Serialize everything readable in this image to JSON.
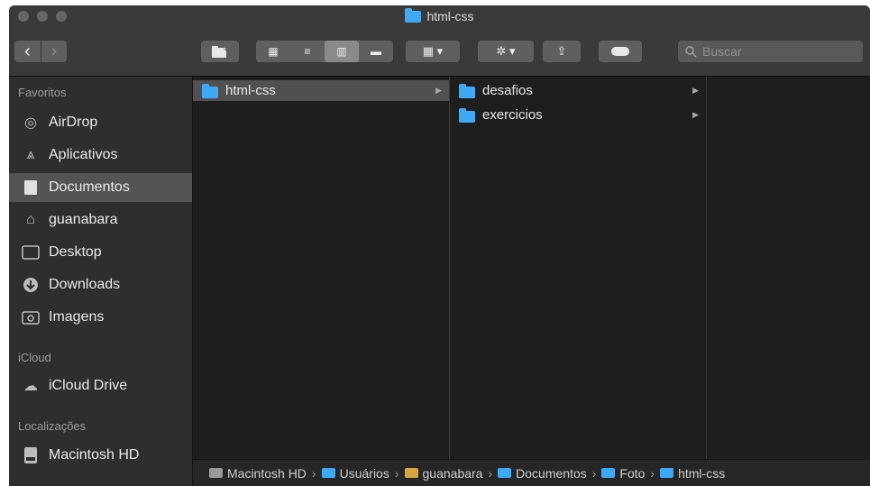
{
  "window": {
    "title": "html-css"
  },
  "toolbar": {
    "back_label": "‹",
    "forward_label": "›",
    "view_icons": [
      "▦",
      "≡",
      "▥",
      "▬"
    ],
    "group_label": "▦ ▾",
    "action_label": "✲ ▾",
    "share_label": "⇪",
    "tag_label": "●",
    "search_placeholder": "Buscar"
  },
  "sidebar": {
    "favorites_label": "Favoritos",
    "favorites": [
      {
        "label": "AirDrop",
        "icon": "airdrop-icon"
      },
      {
        "label": "Aplicativos",
        "icon": "applications-icon"
      },
      {
        "label": "Documentos",
        "icon": "documents-icon",
        "selected": true
      },
      {
        "label": "guanabara",
        "icon": "home-icon"
      },
      {
        "label": "Desktop",
        "icon": "desktop-icon"
      },
      {
        "label": "Downloads",
        "icon": "downloads-icon"
      },
      {
        "label": "Imagens",
        "icon": "pictures-icon"
      }
    ],
    "icloud_label": "iCloud",
    "icloud": [
      {
        "label": "iCloud Drive",
        "icon": "cloud-icon"
      }
    ],
    "locations_label": "Localizações",
    "locations": [
      {
        "label": "Macintosh HD",
        "icon": "disk-icon"
      }
    ]
  },
  "columns": [
    [
      {
        "label": "html-css",
        "selected": true,
        "has_children": true
      }
    ],
    [
      {
        "label": "desafios",
        "has_children": true
      },
      {
        "label": "exercicios",
        "has_children": true
      }
    ]
  ],
  "pathbar": [
    "Macintosh HD",
    "Usuários",
    "guanabara",
    "Documentos",
    "Foto",
    "html-css"
  ],
  "colors": {
    "folder": "#3fa9f5",
    "selection": "#545454",
    "background": "#1e1e1e"
  }
}
